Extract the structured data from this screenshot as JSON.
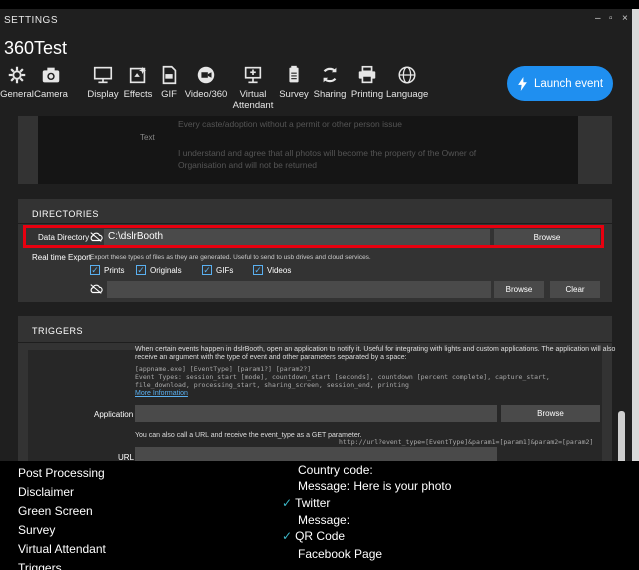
{
  "window": {
    "title": "SETTINGS",
    "profile": "360Test",
    "controls": [
      "–",
      "▫",
      "×"
    ]
  },
  "toolbar": {
    "items": [
      {
        "label": "General",
        "icon": "gear-icon"
      },
      {
        "label": "Camera",
        "icon": "camera-icon"
      },
      {
        "label": "Display",
        "icon": "monitor-icon"
      },
      {
        "label": "Effects",
        "icon": "effects-icon"
      },
      {
        "label": "GIF",
        "icon": "gif-file-icon"
      },
      {
        "label": "Video/360",
        "icon": "video-icon"
      },
      {
        "label": "Virtual Attendant",
        "icon": "kiosk-icon"
      },
      {
        "label": "Survey",
        "icon": "survey-icon"
      },
      {
        "label": "Sharing",
        "icon": "share-icon"
      },
      {
        "label": "Printing",
        "icon": "printer-icon"
      },
      {
        "label": "Language",
        "icon": "globe-icon"
      }
    ],
    "launch_label": "Launch event"
  },
  "legal": {
    "label": "Text",
    "lines": [
      "Every caste/adoption without a permit or other person issue",
      "I understand and agree that all photos will become the property of the Owner of",
      "Organisation and will not be returned"
    ]
  },
  "directories": {
    "title": "DIRECTORIES",
    "data_directory_label": "Data Directory",
    "data_directory_value": "C:\\dslrBooth",
    "browse_label": "Browse",
    "realtime_label": "Real time Export",
    "realtime_desc": "Export these types of files as they are generated. Useful to send to usb drives and cloud services.",
    "options": [
      "Prints",
      "Originals",
      "GIFs",
      "Videos"
    ],
    "realtime_path": "",
    "browse2_label": "Browse",
    "clear_label": "Clear"
  },
  "triggers": {
    "title": "TRIGGERS",
    "desc1": "When certain events happen in dslrBooth, open an application to notify it. Useful for integrating with lights and custom applications. The application will also",
    "desc2": "receive an argument with the type of event and other parameters separated by a space:",
    "code1": "[appname.exe] [EventType] [param1?] [param2?]",
    "code2": "Event Types: session_start [mode], countdown_start [seconds], countdown [percent complete], capture_start,",
    "code3": "file_download, processing_start, sharing_screen, session_end, printing",
    "more_info": "More Information",
    "application_label": "Application",
    "application_value": "",
    "browse_label": "Browse",
    "url_desc": "You can also call a URL and receive the event_type as a GET parameter.",
    "url_example": "http://url?event_type=[EventType]&param1=[param1]&param2=[param2]",
    "url_label": "URL",
    "url_value": ""
  },
  "sidebar": {
    "items": [
      "Post Processing",
      "Disclaimer",
      "Green Screen",
      "Survey",
      "Virtual Attendant",
      "Triggers"
    ]
  },
  "sharing_preview": {
    "country_code": "Country code:",
    "message1": "Message:  Here is your photo",
    "twitter": "Twitter",
    "message2": "Message:",
    "qr": "QR Code",
    "facebook": "Facebook Page"
  },
  "colors": {
    "accent": "#1f8ff0",
    "highlight": "#e8000f",
    "check": "#3cb8c8"
  }
}
